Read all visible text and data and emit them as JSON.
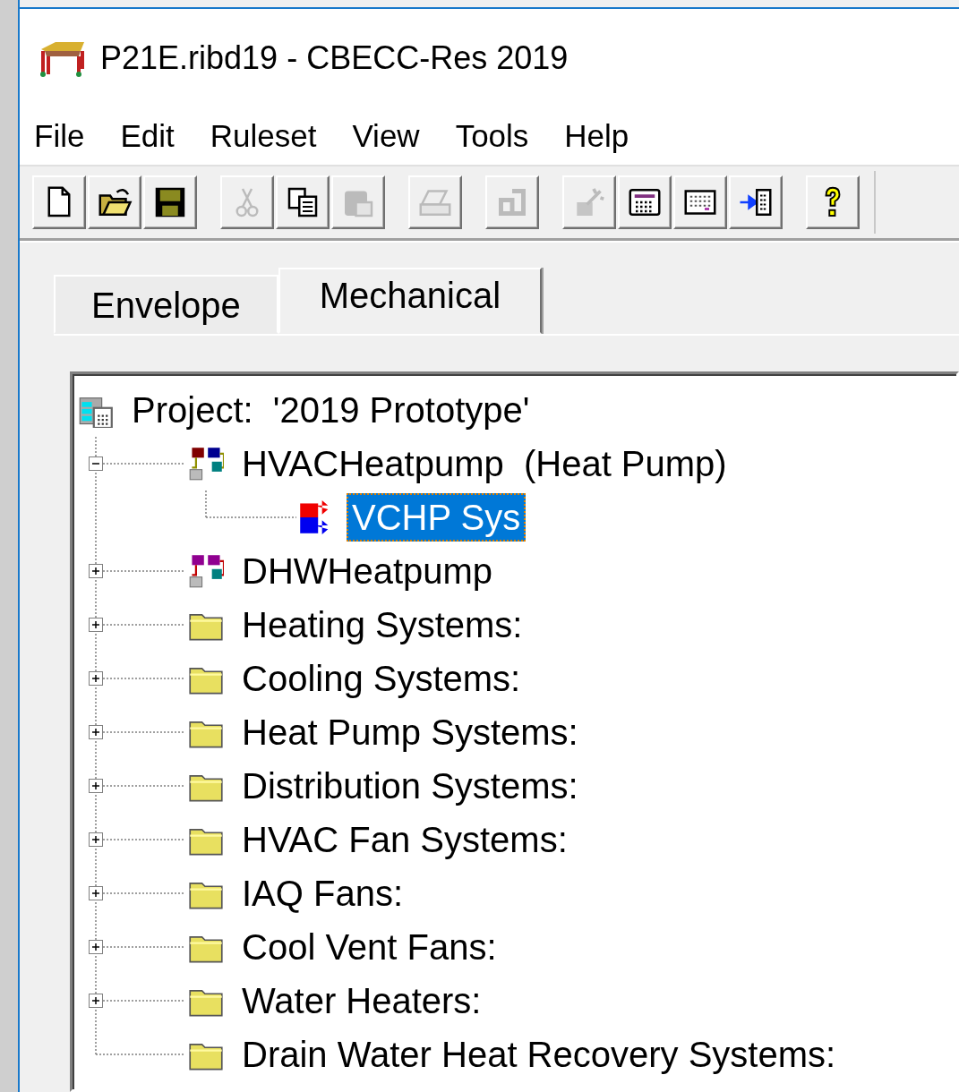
{
  "window": {
    "title": "P21E.ribd19 - CBECC-Res 2019"
  },
  "menu": [
    "File",
    "Edit",
    "Ruleset",
    "View",
    "Tools",
    "Help"
  ],
  "toolbar": [
    [
      {
        "kind": "new",
        "disabled": false
      },
      {
        "kind": "open",
        "disabled": false
      },
      {
        "kind": "save",
        "disabled": false
      }
    ],
    [
      {
        "kind": "cut",
        "disabled": true
      },
      {
        "kind": "copy",
        "disabled": false
      },
      {
        "kind": "paste",
        "disabled": true
      }
    ],
    [
      {
        "kind": "print",
        "disabled": true
      }
    ],
    [
      {
        "kind": "undo",
        "disabled": true
      }
    ],
    [
      {
        "kind": "wand",
        "disabled": true
      },
      {
        "kind": "calc",
        "disabled": false
      },
      {
        "kind": "grid",
        "disabled": false
      },
      {
        "kind": "import",
        "disabled": false
      }
    ],
    [
      {
        "kind": "help",
        "disabled": false
      }
    ]
  ],
  "tabs": [
    {
      "label": "Envelope",
      "selected": false
    },
    {
      "label": "Mechanical",
      "selected": true
    }
  ],
  "tree": {
    "label": "Project:  '2019 Prototype'",
    "kind": "project",
    "selected": false,
    "children": [
      {
        "label": "HVACHeatpump  (Heat Pump)",
        "kind": "hvac",
        "expanded": true,
        "selected": false,
        "children": [
          {
            "label": "VCHP Sys",
            "kind": "system",
            "selected": true
          }
        ]
      },
      {
        "label": "DHWHeatpump",
        "kind": "dhw",
        "expanded": false,
        "selected": false
      },
      {
        "label": "Heating Systems:",
        "kind": "folder",
        "expanded": false,
        "selected": false
      },
      {
        "label": "Cooling Systems:",
        "kind": "folder",
        "expanded": false,
        "selected": false
      },
      {
        "label": "Heat Pump Systems:",
        "kind": "folder",
        "expanded": false,
        "selected": false
      },
      {
        "label": "Distribution Systems:",
        "kind": "folder",
        "expanded": false,
        "selected": false
      },
      {
        "label": "HVAC Fan Systems:",
        "kind": "folder",
        "expanded": false,
        "selected": false
      },
      {
        "label": "IAQ Fans:",
        "kind": "folder",
        "expanded": false,
        "selected": false
      },
      {
        "label": "Cool Vent Fans:",
        "kind": "folder",
        "expanded": false,
        "selected": false
      },
      {
        "label": "Water Heaters:",
        "kind": "folder",
        "expanded": false,
        "selected": false
      },
      {
        "label": "Drain Water Heat Recovery Systems:",
        "kind": "folder",
        "selected": false
      }
    ]
  }
}
